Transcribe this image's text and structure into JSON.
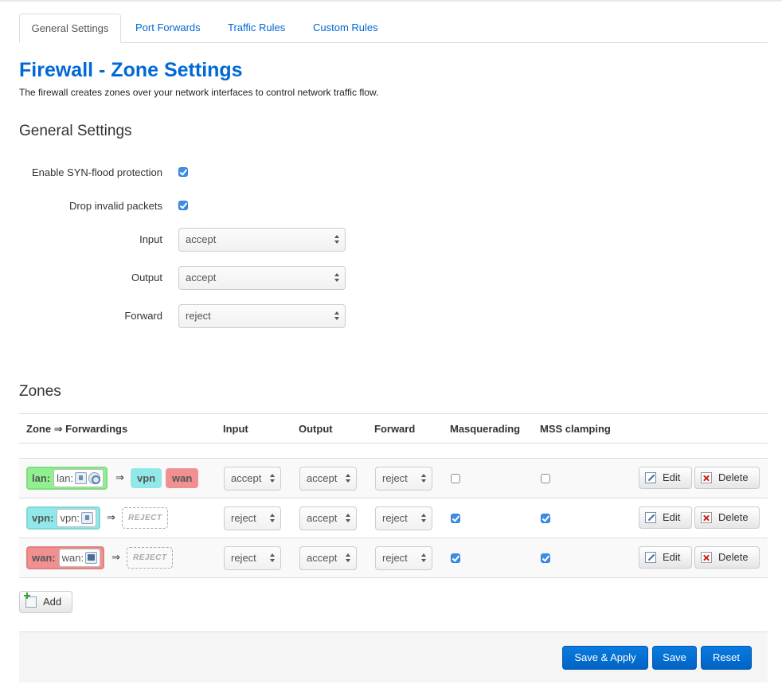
{
  "tabs": [
    {
      "label": "General Settings"
    },
    {
      "label": "Port Forwards"
    },
    {
      "label": "Traffic Rules"
    },
    {
      "label": "Custom Rules"
    }
  ],
  "page": {
    "title": "Firewall - Zone Settings",
    "description": "The firewall creates zones over your network interfaces to control network traffic flow."
  },
  "general": {
    "heading": "General Settings",
    "syn_flood": {
      "label": "Enable SYN-flood protection",
      "checked": true
    },
    "drop_invalid": {
      "label": "Drop invalid packets",
      "checked": true
    },
    "input": {
      "label": "Input",
      "value": "accept"
    },
    "output": {
      "label": "Output",
      "value": "accept"
    },
    "forward": {
      "label": "Forward",
      "value": "reject"
    }
  },
  "zones": {
    "heading": "Zones",
    "columns": [
      "Zone ⇒ Forwardings",
      "Input",
      "Output",
      "Forward",
      "Masquerading",
      "MSS clamping"
    ],
    "arrow": "⇒",
    "rows": [
      {
        "zone": "lan:",
        "iface": "lan:",
        "color": "#90f090",
        "forwards": [
          {
            "label": "vpn",
            "color": "#90e8e8"
          },
          {
            "label": "wan",
            "color": "#f09090"
          }
        ],
        "input": "accept",
        "output": "accept",
        "forward": "reject",
        "masq": false,
        "mss": false
      },
      {
        "zone": "vpn:",
        "iface": "vpn:",
        "color": "#90e8e8",
        "reject": "REJECT",
        "input": "reject",
        "output": "accept",
        "forward": "reject",
        "masq": true,
        "mss": true
      },
      {
        "zone": "wan:",
        "iface": "wan:",
        "color": "#f09090",
        "reject": "REJECT",
        "input": "reject",
        "output": "accept",
        "forward": "reject",
        "masq": true,
        "mss": true
      }
    ],
    "edit_label": "Edit",
    "delete_label": "Delete",
    "add_label": "Add"
  },
  "footer": {
    "save_apply": "Save & Apply",
    "save": "Save",
    "reset": "Reset"
  }
}
